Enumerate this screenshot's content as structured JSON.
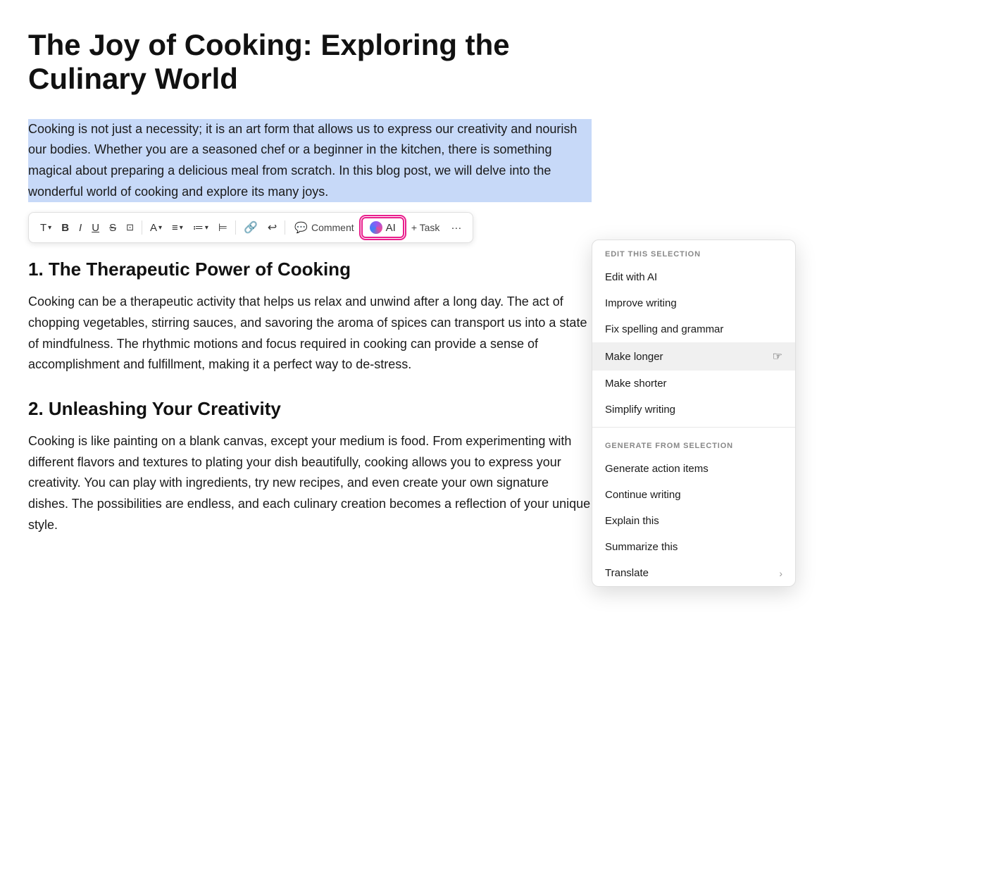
{
  "document": {
    "title": "The Joy of Cooking: Exploring the Culinary World",
    "selected_paragraph": "Cooking is not just a necessity; it is an art form that allows us to express our creativity and nourish our bodies. Whether you are a seasoned chef or a beginner in the kitchen, there is something magical about preparing a delicious meal from scratch. In this blog post, we will delve into the wonderful world of cooking and explore its many joys.",
    "sections": [
      {
        "number": "1.",
        "heading": "The Therapeutic Power of Cooking",
        "body": "Cooking can be a therapeutic activity that helps us relax and unwind after a long day. The act of chopping vegetables, stirring sauces, and savoring the aroma of spices can transport us into a state of mindfulness. The rhythmic motions and focus required in cooking can provide a sense of accomplishment and fulfillment, making it a perfect way to de-stress."
      },
      {
        "number": "2.",
        "heading": "Unleashing Your Creativity",
        "body": "Cooking is like painting on a blank canvas, except your medium is food. From experimenting with different flavors and textures to plating your dish beautifully, cooking allows you to express your creativity. You can play with ingredients, try new recipes, and even create your own signature dishes. The possibilities are endless, and each culinary creation becomes a reflection of your unique style."
      }
    ]
  },
  "toolbar": {
    "text_label": "T",
    "bold_label": "B",
    "italic_label": "I",
    "underline_label": "U",
    "strikethrough_label": "S",
    "frame_label": "⊡",
    "font_label": "A",
    "align_label": "≡",
    "list_label": "≔",
    "outdent_label": "⊨",
    "link_label": "🔗",
    "undo_label": "↩",
    "comment_label": "Comment",
    "ai_label": "AI",
    "task_label": "+ Task",
    "more_label": "···"
  },
  "ai_menu": {
    "edit_section_header": "EDIT THIS SELECTION",
    "generate_section_header": "GENERATE FROM SELECTION",
    "edit_items": [
      {
        "label": "Edit with AI",
        "id": "edit-with-ai"
      },
      {
        "label": "Improve writing",
        "id": "improve-writing"
      },
      {
        "label": "Fix spelling and grammar",
        "id": "fix-spelling"
      },
      {
        "label": "Make longer",
        "id": "make-longer",
        "hovered": true
      },
      {
        "label": "Make shorter",
        "id": "make-shorter"
      },
      {
        "label": "Simplify writing",
        "id": "simplify-writing"
      }
    ],
    "generate_items": [
      {
        "label": "Generate action items",
        "id": "generate-action-items"
      },
      {
        "label": "Continue writing",
        "id": "continue-writing"
      },
      {
        "label": "Explain this",
        "id": "explain-this"
      },
      {
        "label": "Summarize this",
        "id": "summarize-this"
      },
      {
        "label": "Translate",
        "id": "translate",
        "has_arrow": true
      }
    ]
  }
}
